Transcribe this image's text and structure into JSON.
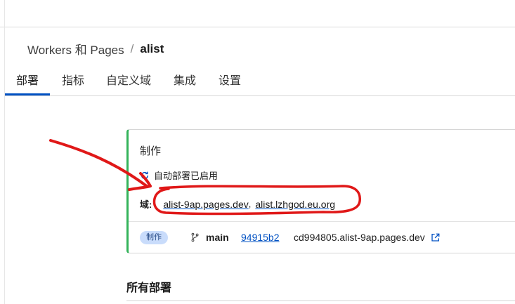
{
  "breadcrumb": {
    "parent": "Workers 和 Pages",
    "separator": "/",
    "current": "alist"
  },
  "tabs": [
    {
      "label": "部署"
    },
    {
      "label": "指标"
    },
    {
      "label": "自定义域"
    },
    {
      "label": "集成"
    },
    {
      "label": "设置"
    }
  ],
  "production": {
    "title": "制作",
    "autodeploy": "自动部署已启用",
    "domains_label": "域:",
    "domains": [
      "alist-9ap.pages.dev",
      "alist.lzhgod.eu.org"
    ],
    "badge": "制作",
    "branch": "main",
    "commit": "94915b2",
    "preview_url": "cd994805.alist-9ap.pages.dev"
  },
  "all_deployments_title": "所有部署",
  "colors": {
    "accent": "#0051c3",
    "success": "#34b35a",
    "annotation": "#e01818"
  }
}
